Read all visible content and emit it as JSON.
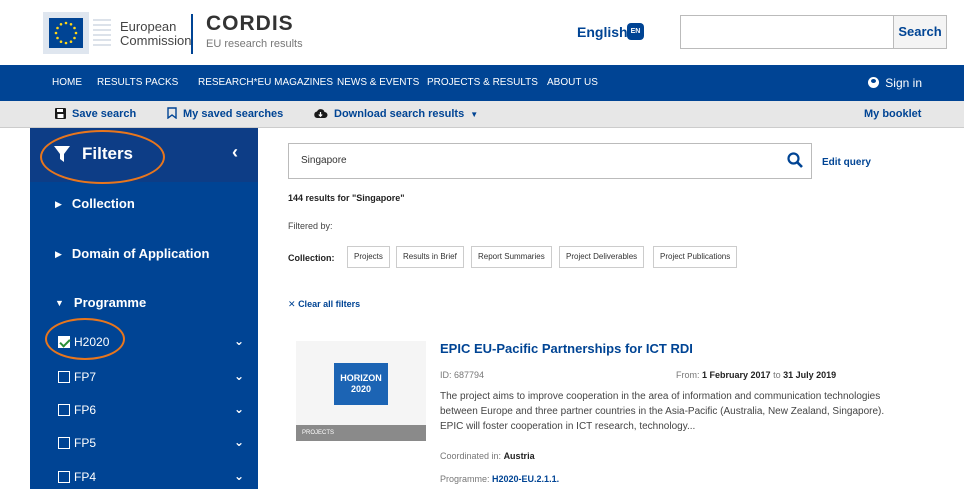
{
  "header": {
    "ec_text_line1": "European",
    "ec_text_line2": "Commission",
    "cordis_title": "CORDIS",
    "cordis_subtitle": "EU research results",
    "language": "English",
    "language_code": "EN",
    "search_placeholder": "",
    "search_button": "Search"
  },
  "nav": {
    "items": [
      "HOME",
      "RESULTS PACKS",
      "RESEARCH*EU MAGAZINES",
      "NEWS & EVENTS",
      "PROJECTS & RESULTS",
      "ABOUT US"
    ],
    "sign_in": "Sign in"
  },
  "toolbar": {
    "save_search": "Save search",
    "my_saved_searches": "My saved searches",
    "download": "Download search results",
    "my_booklet": "My booklet"
  },
  "sidebar": {
    "title": "Filters",
    "sections": [
      "Collection",
      "Domain of Application",
      "Programme"
    ],
    "programmes": [
      {
        "label": "H2020",
        "checked": true
      },
      {
        "label": "FP7",
        "checked": false
      },
      {
        "label": "FP6",
        "checked": false
      },
      {
        "label": "FP5",
        "checked": false
      },
      {
        "label": "FP4",
        "checked": false
      }
    ]
  },
  "main": {
    "query": "Singapore",
    "edit_query": "Edit query",
    "result_count": "144 results for \"Singapore\"",
    "filtered_by": "Filtered by:",
    "collection_label": "Collection:",
    "chips": [
      "Projects",
      "Results in Brief",
      "Report Summaries",
      "Project Deliverables",
      "Project Publications"
    ],
    "clear_filters": "Clear all filters"
  },
  "result": {
    "thumb_line1": "HORIZON",
    "thumb_line2": "2020",
    "thumb_tag": "PROJECTS",
    "title": "EPIC EU-Pacific Partnerships for ICT RDI",
    "id": "ID: 687794",
    "from_label": "From:",
    "from_date": "1 February 2017",
    "to_label": "to",
    "to_date": "31 July 2019",
    "description": "The project aims to improve cooperation in the area of information and communication technologies between Europe and three partner countries in the Asia-Pacific (Australia, New Zealand, Singapore). EPIC will foster cooperation in ICT research, technology...",
    "coordinated_label": "Coordinated in:",
    "coordinated_value": "Austria",
    "programme_label": "Programme:",
    "programme_value": "H2020-EU.2.1.1."
  },
  "colors": {
    "brand_blue": "#004494",
    "annotation_orange": "#e8761d"
  }
}
